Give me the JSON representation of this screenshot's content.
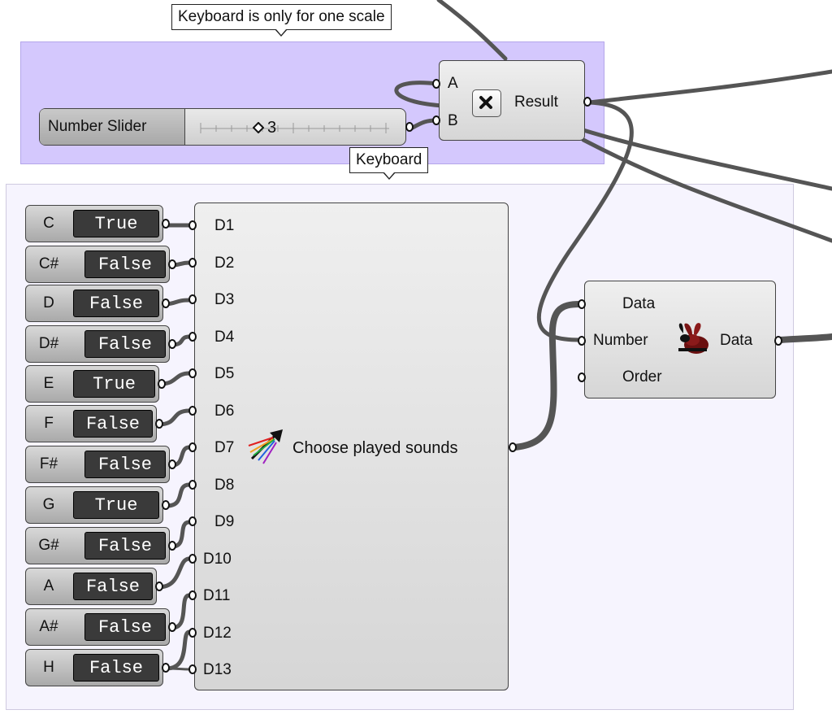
{
  "groups": {
    "scale": {
      "tag": "Keyboard is only for one scale"
    },
    "keyboard": {
      "tag": "Keyboard"
    }
  },
  "slider": {
    "label": "Number Slider",
    "value": "3",
    "value_num": 3
  },
  "multiply": {
    "input_a": "A",
    "input_b": "B",
    "output": "Result",
    "icon": "multiply-x-icon"
  },
  "toggles": [
    {
      "note": "C",
      "value": "True"
    },
    {
      "note": "C#",
      "value": "False"
    },
    {
      "note": "D",
      "value": "False"
    },
    {
      "note": "D#",
      "value": "False"
    },
    {
      "note": "E",
      "value": "True"
    },
    {
      "note": "F",
      "value": "False"
    },
    {
      "note": "F#",
      "value": "False"
    },
    {
      "note": "G",
      "value": "True"
    },
    {
      "note": "G#",
      "value": "False"
    },
    {
      "note": "A",
      "value": "False"
    },
    {
      "note": "A#",
      "value": "False"
    },
    {
      "note": "H",
      "value": "False"
    }
  ],
  "merge": {
    "inputs": [
      "D1",
      "D2",
      "D3",
      "D4",
      "D5",
      "D6",
      "D7",
      "D8",
      "D9",
      "D10",
      "D11",
      "D12",
      "D13"
    ],
    "label": "Choose played sounds",
    "icon": "color-arrow-icon"
  },
  "shift": {
    "inputs": [
      "Data",
      "Number",
      "Order"
    ],
    "output": "Data",
    "icon": "rabbit-icon"
  },
  "colors": {
    "group_scale": "#d4c8fd",
    "group_keyboard": "#f6f4fe",
    "wire": "#555555",
    "toggle_value_bg": "#3a3a3a"
  }
}
